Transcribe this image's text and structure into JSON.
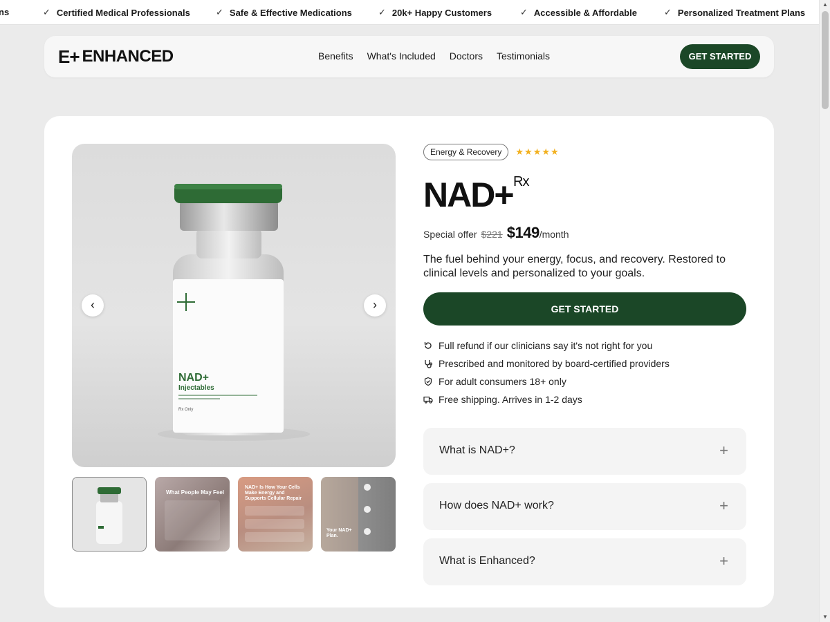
{
  "ticker": [
    {
      "label": "ns",
      "check": false
    },
    {
      "label": "Certified Medical Professionals",
      "check": true
    },
    {
      "label": "Safe & Effective Medications",
      "check": true
    },
    {
      "label": "20k+ Happy Customers",
      "check": true
    },
    {
      "label": "Accessible & Affordable",
      "check": true
    },
    {
      "label": "Personalized Treatment Plans",
      "check": true
    }
  ],
  "header": {
    "logo_mark": "E+",
    "logo_text": "ENHANCED",
    "nav": [
      "Benefits",
      "What's Included",
      "Doctors",
      "Testimonials"
    ],
    "cta": "GET STARTED"
  },
  "gallery": {
    "vial_label_title": "NAD+",
    "vial_label_sub": "Injectables",
    "vial_label_small": "Rx Only",
    "thumbs": [
      {
        "caption": ""
      },
      {
        "caption": "What People May Feel"
      },
      {
        "caption": "NAD+ Is How Your Cells Make Energy and Supports Cellular Repair"
      },
      {
        "caption": "Your NAD+ Plan."
      }
    ],
    "prev": "‹",
    "next": "›"
  },
  "product": {
    "category": "Energy & Recovery",
    "stars": "★★★★★",
    "rating": 5,
    "title": "NAD+",
    "rx": "Rx",
    "offer_label": "Special offer",
    "old_price": "$221",
    "price": "$149",
    "per": "/month",
    "description": "The fuel behind your energy, focus, and recovery. Restored to clinical levels and personalized to your goals.",
    "cta": "GET STARTED",
    "features": [
      {
        "icon": "refund-icon",
        "text": "Full refund if our clinicians say it's not right for you"
      },
      {
        "icon": "stethoscope-icon",
        "text": "Prescribed and monitored by board-certified providers"
      },
      {
        "icon": "shield-check-icon",
        "text": "For adult consumers 18+ only"
      },
      {
        "icon": "truck-icon",
        "text": "Free shipping. Arrives in 1-2 days"
      }
    ],
    "faqs": [
      {
        "question": "What is NAD+?",
        "icon": "+"
      },
      {
        "question": "How does NAD+ work?",
        "icon": "+"
      },
      {
        "question": "What is Enhanced?",
        "icon": "+"
      }
    ]
  },
  "colors": {
    "brand_green": "#1b4727",
    "star": "#f2b01e",
    "cap_green": "#2e6b35"
  }
}
